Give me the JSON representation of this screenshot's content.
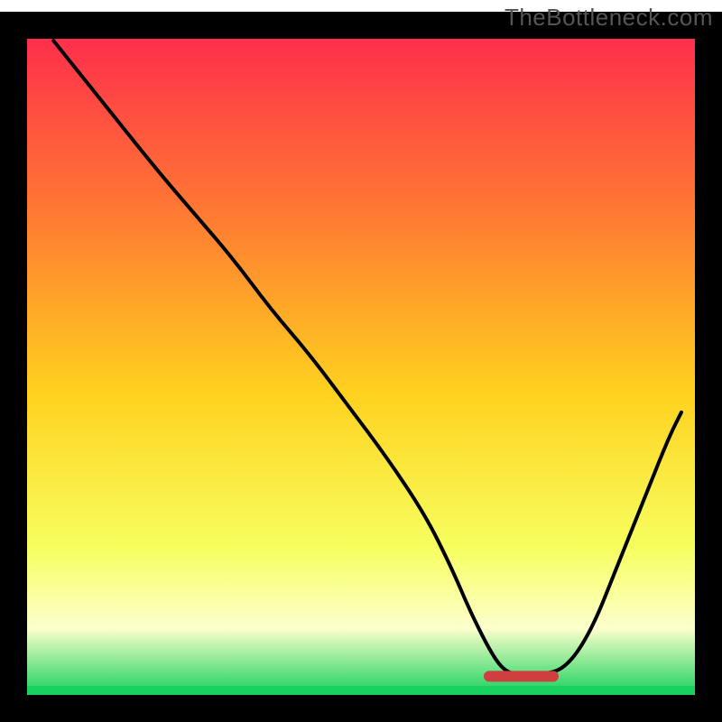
{
  "watermark": "TheBottleneck.com",
  "colors": {
    "gradient_top": "#ff2a4d",
    "gradient_mid1": "#ff7a33",
    "gradient_mid2": "#ffd21f",
    "gradient_mid3": "#f6ff60",
    "gradient_bottom_band": "#fdffcc",
    "gradient_green": "#18d15e",
    "curve": "#000000",
    "border": "#000000",
    "dash": "#d03f3f"
  },
  "chart_data": {
    "type": "line",
    "title": "",
    "xlabel": "",
    "ylabel": "",
    "xlim": [
      0,
      100
    ],
    "ylim": [
      0,
      100
    ],
    "grid": false,
    "legend": false,
    "series": [
      {
        "name": "bottleneck-curve",
        "x": [
          2,
          10,
          18,
          24,
          30,
          36,
          42,
          48,
          54,
          60,
          64,
          67,
          70,
          72,
          74,
          78,
          82,
          86,
          90,
          94,
          98,
          100
        ],
        "values": [
          100,
          90,
          80,
          73,
          66,
          58,
          51,
          43,
          35,
          26,
          18,
          11,
          5,
          2,
          1,
          1,
          2,
          8,
          18,
          28,
          38,
          42
        ]
      }
    ],
    "annotations": [
      {
        "name": "optimal-dash",
        "type": "segment",
        "x_start": 70,
        "x_end": 80,
        "y": 0.8,
        "color": "#d03f3f"
      }
    ]
  }
}
